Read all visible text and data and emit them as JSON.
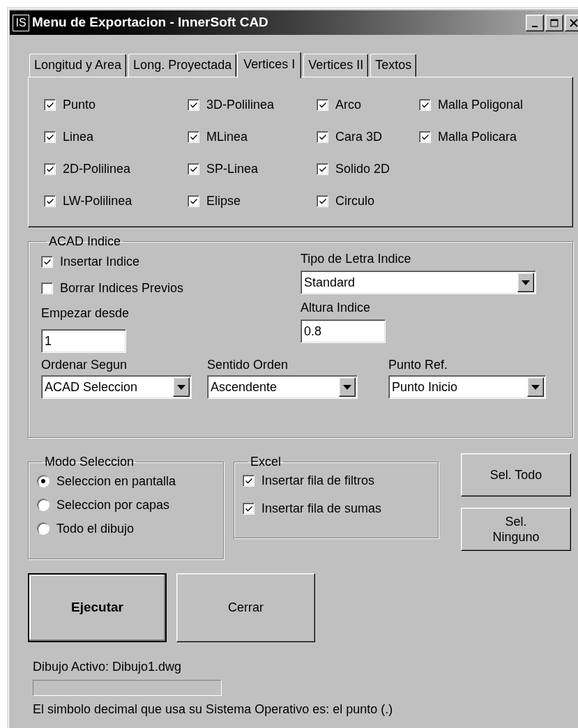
{
  "window": {
    "icon_text": "IS",
    "title": "Menu de Exportacion - InnerSoft CAD"
  },
  "tabs": [
    {
      "label": "Longitud y Area",
      "selected": false
    },
    {
      "label": "Long. Proyectada",
      "selected": false
    },
    {
      "label": "Vertices I",
      "selected": true
    },
    {
      "label": "Vertices II",
      "selected": false
    },
    {
      "label": "Textos",
      "selected": false
    }
  ],
  "entity_columns": [
    [
      {
        "label": "Punto",
        "checked": true
      },
      {
        "label": "Linea",
        "checked": true
      },
      {
        "label": "2D-Polilinea",
        "checked": true
      },
      {
        "label": "LW-Polilinea",
        "checked": true
      }
    ],
    [
      {
        "label": "3D-Polilinea",
        "checked": true
      },
      {
        "label": "MLinea",
        "checked": true
      },
      {
        "label": "SP-Linea",
        "checked": true
      },
      {
        "label": "Elipse",
        "checked": true
      }
    ],
    [
      {
        "label": "Arco",
        "checked": true
      },
      {
        "label": "Cara 3D",
        "checked": true
      },
      {
        "label": "Solido 2D",
        "checked": true
      },
      {
        "label": "Circulo",
        "checked": true
      }
    ],
    [
      {
        "label": "Malla Poligonal",
        "checked": true
      },
      {
        "label": "Malla Policara",
        "checked": true
      }
    ]
  ],
  "acad_indice": {
    "title": "ACAD Indice",
    "insert_index": {
      "label": "Insertar Indice",
      "checked": true
    },
    "clear_previous": {
      "label": "Borrar Indices Previos",
      "checked": false
    },
    "start_from": {
      "label": "Empezar desde",
      "value": "1"
    },
    "font": {
      "label": "Tipo de Letra Indice",
      "value": "Standard"
    },
    "height": {
      "label": "Altura Indice",
      "value": "0.8"
    },
    "dropdowns": [
      {
        "label": "Ordenar Segun",
        "value": "ACAD Seleccion"
      },
      {
        "label": "Sentido Orden",
        "value": "Ascendente"
      },
      {
        "label": "Punto Ref.",
        "value": "Punto Inicio"
      }
    ]
  },
  "selection_mode": {
    "title": "Modo Seleccion",
    "options": [
      {
        "label": "Seleccion en pantalla",
        "selected": true
      },
      {
        "label": "Seleccion por capas",
        "selected": false
      },
      {
        "label": "Todo el dibujo",
        "selected": false
      }
    ]
  },
  "excel": {
    "title": "Excel",
    "options": [
      {
        "label": "Insertar fila de filtros",
        "checked": true
      },
      {
        "label": "Insertar fila de sumas",
        "checked": true
      }
    ]
  },
  "side_buttons": [
    "Sel. Todo",
    "Sel.\nNinguno"
  ],
  "main_buttons": [
    {
      "label": "Ejecutar",
      "default": true
    },
    {
      "label": "Cerrar",
      "default": false
    }
  ],
  "active_drawing": "Dibujo Activo: Dibujo1.dwg",
  "progress": {
    "level": 0
  },
  "decimal_note": "El simbolo decimal que usa su Sistema Operativo es: el punto (.)"
}
